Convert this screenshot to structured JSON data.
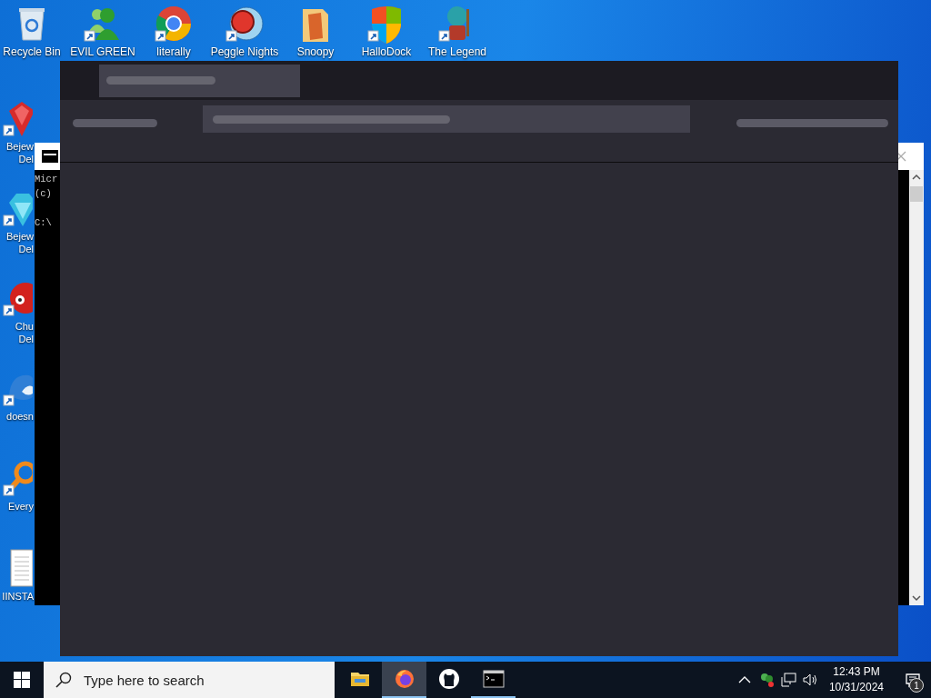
{
  "desktop_icons_top": [
    {
      "label": "Recycle Bin"
    },
    {
      "label": "EVIL GREEN"
    },
    {
      "label": "literally"
    },
    {
      "label": "Peggle Nights"
    },
    {
      "label": "Snoopy"
    },
    {
      "label": "HalloDock"
    },
    {
      "label": "The Legend"
    }
  ],
  "desktop_icons_left": [
    {
      "label_lines": [
        "Bejew",
        "Del"
      ]
    },
    {
      "label_lines": [
        "Bejew",
        "Del"
      ]
    },
    {
      "label_lines": [
        "Chu",
        "Del"
      ]
    },
    {
      "label_lines": [
        "doesn"
      ]
    },
    {
      "label_lines": [
        "Every"
      ]
    },
    {
      "label_lines": [
        "IINSTA"
      ]
    }
  ],
  "console_window": {
    "lines": [
      "Micr",
      "(c)"
    ],
    "prompt": "C:\\"
  },
  "taskbar": {
    "search": {
      "placeholder": "Type here to search"
    },
    "apps": [
      {
        "active": false,
        "running": false
      },
      {
        "active": true,
        "running": true
      },
      {
        "active": false,
        "running": false
      },
      {
        "active": false,
        "running": true
      }
    ],
    "clock": {
      "time": "12:43 PM",
      "date": "10/31/2024"
    },
    "notifications": {
      "count": "1"
    }
  }
}
